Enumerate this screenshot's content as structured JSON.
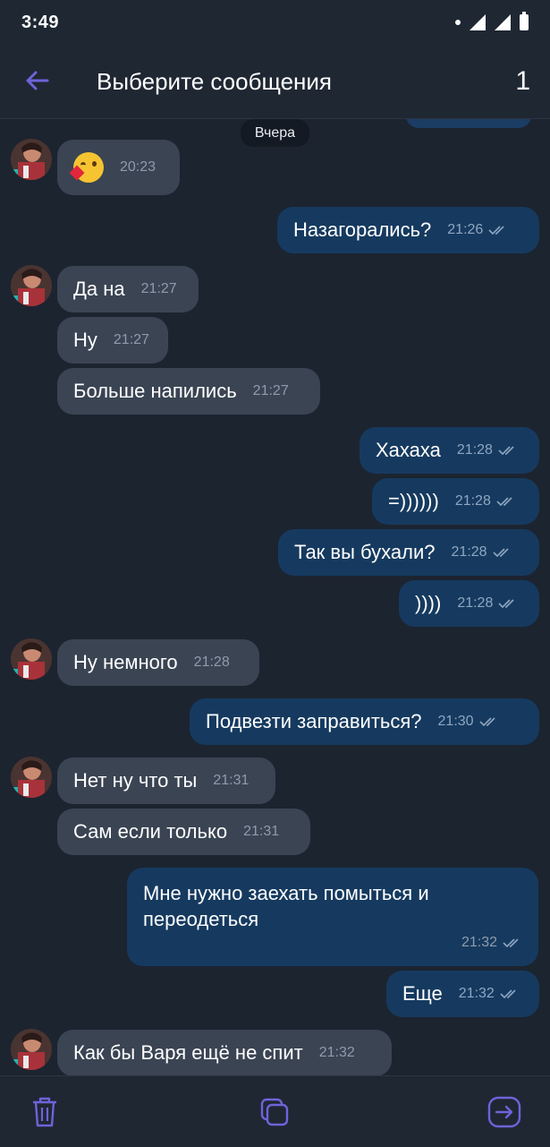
{
  "status_bar": {
    "time": "3:49"
  },
  "header": {
    "title": "Выберите сообщения",
    "selected_count": "1"
  },
  "chat": {
    "date_separator": "Вчера",
    "messages": [
      {
        "direction": "in",
        "emoji": "kiss-wink-emoji",
        "time": "20:23"
      },
      {
        "direction": "out",
        "text": "Назагорались?",
        "time": "21:26"
      },
      {
        "direction": "in",
        "text": "Да на",
        "time": "21:27"
      },
      {
        "direction": "in",
        "text": "Ну",
        "time": "21:27"
      },
      {
        "direction": "in",
        "text": "Больше напились",
        "time": "21:27"
      },
      {
        "direction": "out",
        "text": "Хахаха",
        "time": "21:28"
      },
      {
        "direction": "out",
        "text": "=))))))",
        "time": "21:28"
      },
      {
        "direction": "out",
        "text": "Так вы бухали?",
        "time": "21:28"
      },
      {
        "direction": "out",
        "text": "))))",
        "time": "21:28"
      },
      {
        "direction": "in",
        "text": "Ну немного",
        "time": "21:28"
      },
      {
        "direction": "out",
        "text": "Подвезти заправиться?",
        "time": "21:30"
      },
      {
        "direction": "in",
        "text": "Нет ну что ты",
        "time": "21:31"
      },
      {
        "direction": "in",
        "text": "Сам если только",
        "time": "21:31"
      },
      {
        "direction": "out",
        "text": "Мне нужно заехать помыться и переодеться",
        "line1": "Мне нужно заехать помыться и",
        "line2": "переодеться",
        "time": "21:32"
      },
      {
        "direction": "out",
        "text": "Еще",
        "time": "21:32"
      },
      {
        "direction": "in",
        "text": "Как бы Варя ещё не спит",
        "time": "21:32"
      }
    ]
  },
  "bottom_bar": {
    "icons": [
      "trash-icon",
      "copy-icon",
      "forward-icon"
    ]
  },
  "colors": {
    "accent": "#6f63d9",
    "background": "#1c2430",
    "incoming": "#3a4453",
    "outgoing": "#163a5f"
  }
}
